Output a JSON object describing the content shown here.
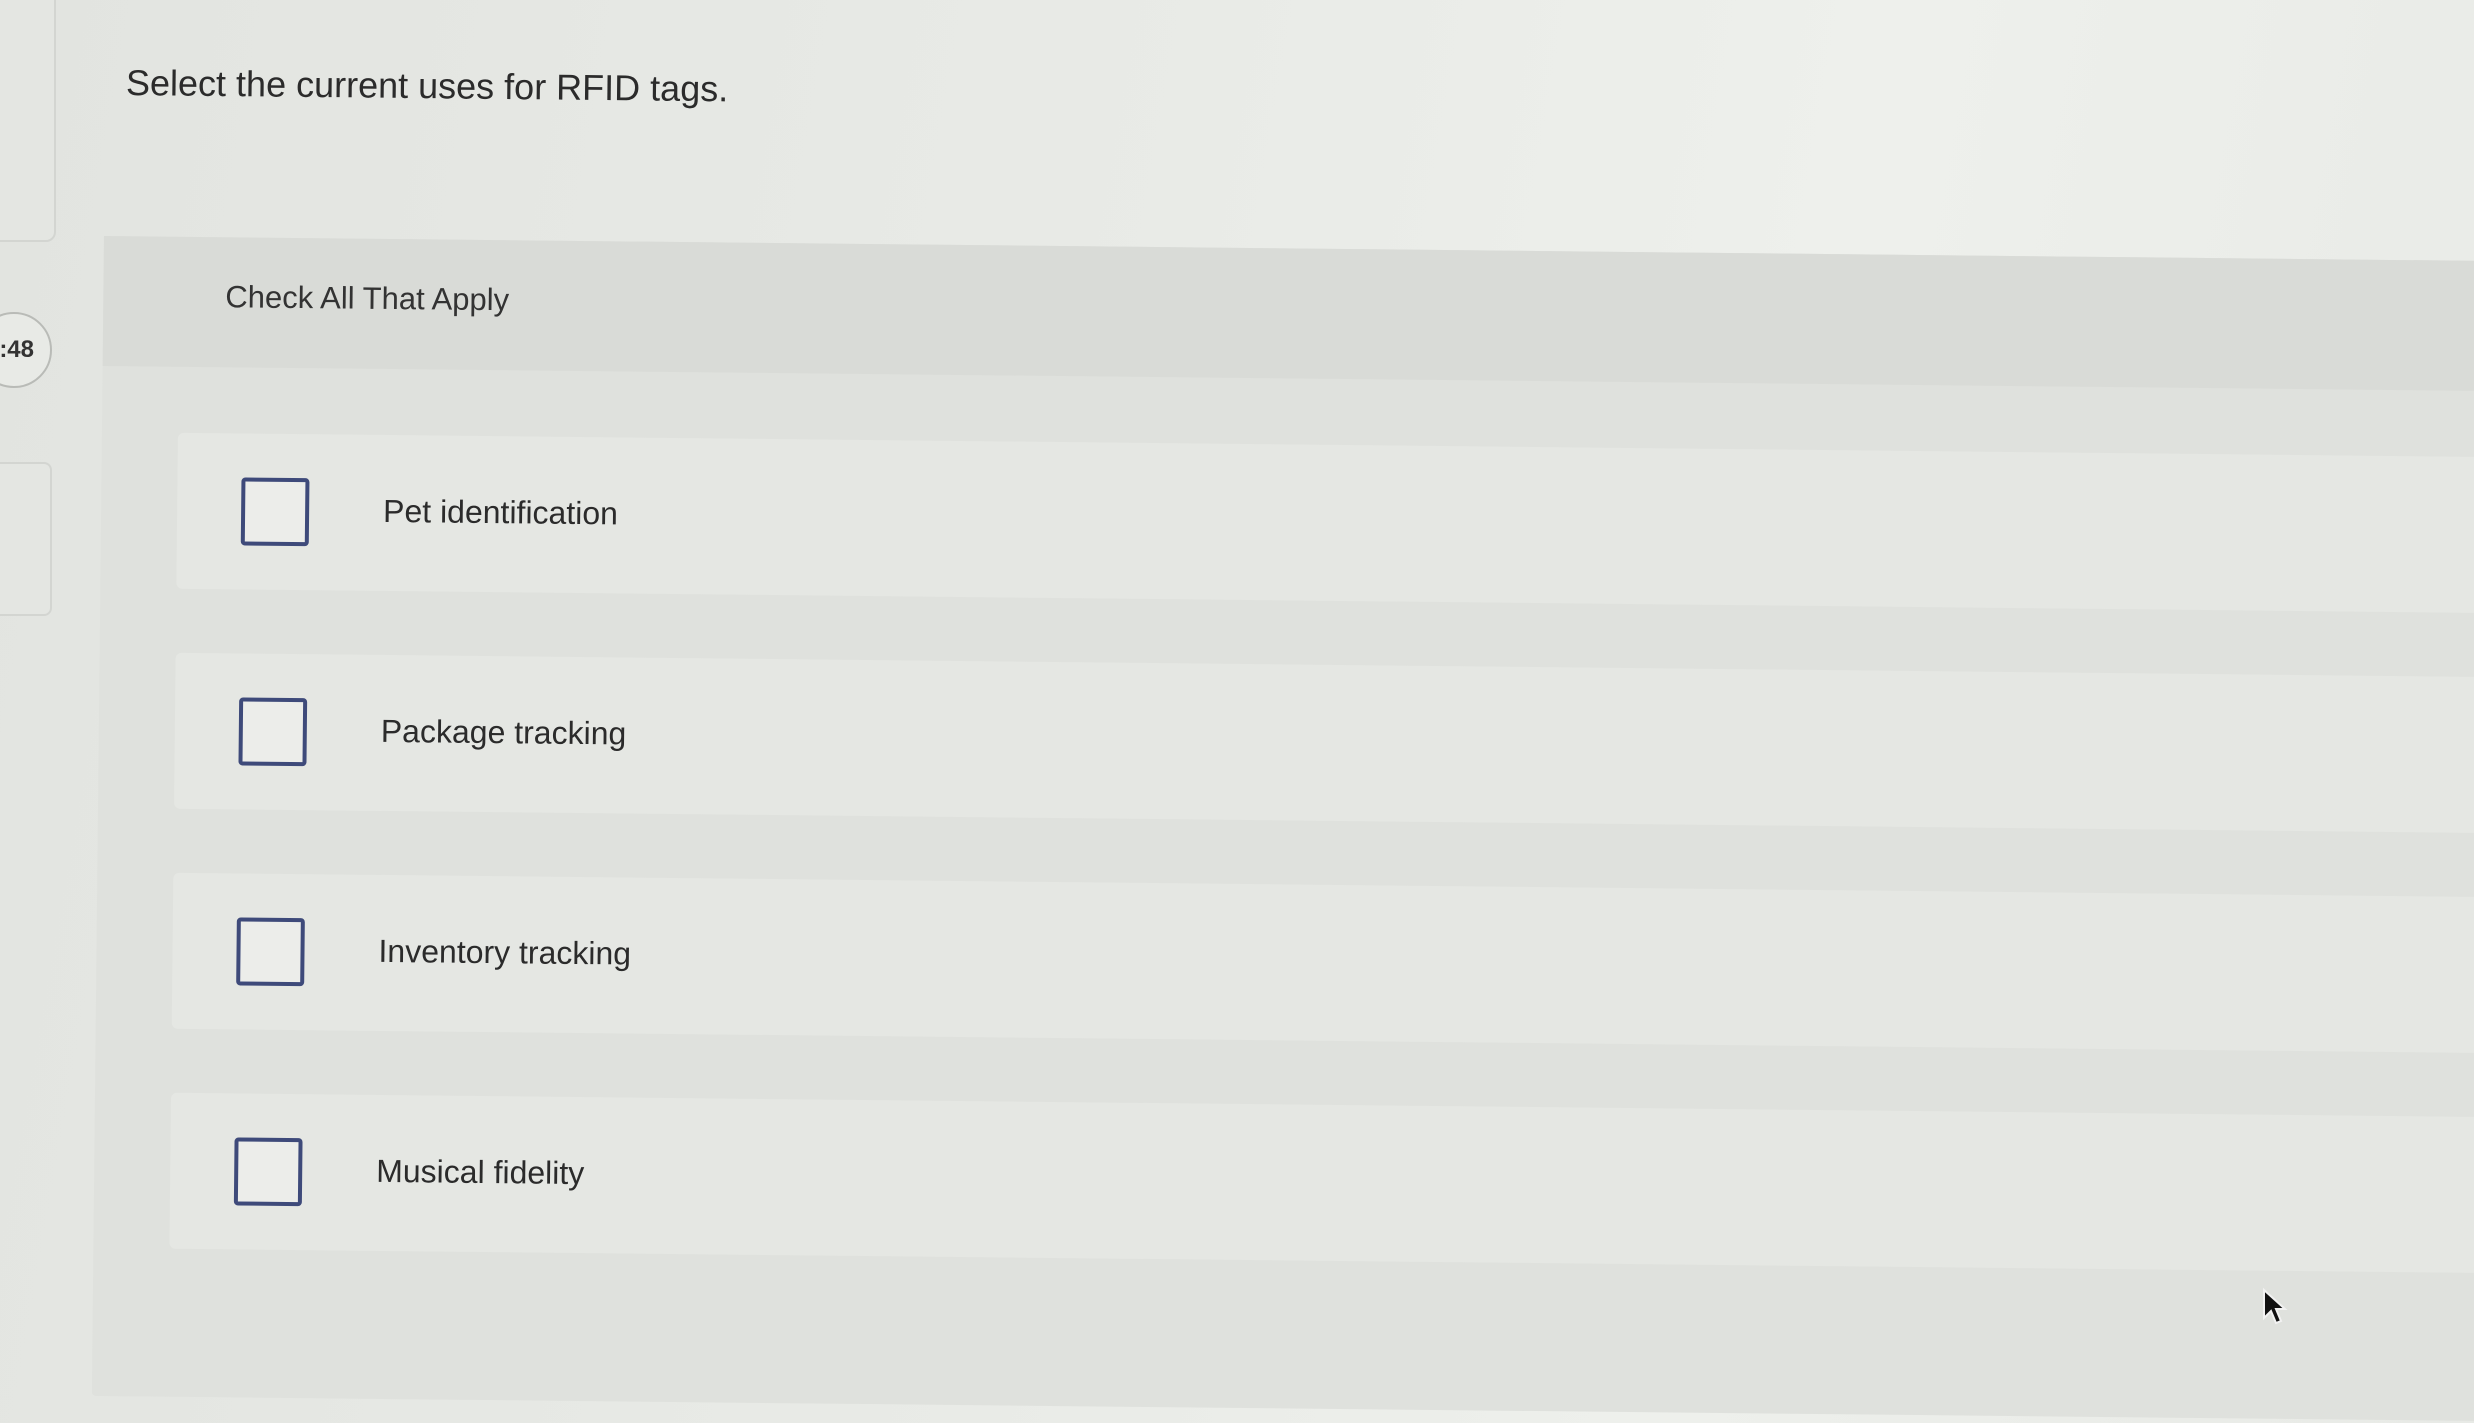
{
  "question": {
    "number": ":48",
    "prompt": "Select the current uses for RFID tags.",
    "instruction": "Check All That Apply",
    "options": [
      {
        "label": "Pet identification",
        "checked": false
      },
      {
        "label": "Package tracking",
        "checked": false
      },
      {
        "label": "Inventory tracking",
        "checked": false
      },
      {
        "label": "Musical fidelity",
        "checked": false
      }
    ]
  },
  "colors": {
    "checkbox_border": "#3e4a7a",
    "background": "#e6e8e4"
  }
}
